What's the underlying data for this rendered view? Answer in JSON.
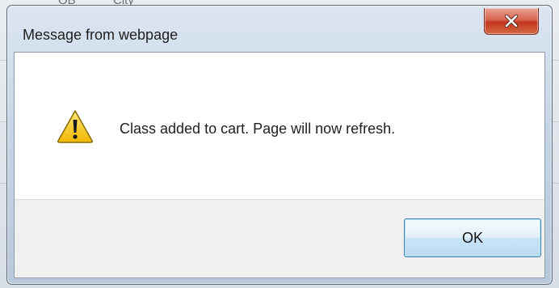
{
  "background_page": {
    "header_cells": [
      "OB",
      "City"
    ]
  },
  "dialog": {
    "title": "Message from webpage",
    "icon": "warning-icon",
    "message": "Class added to cart.  Page will now refresh.",
    "ok_label": "OK",
    "close_icon": "close-icon"
  },
  "colors": {
    "close_button": "#c8452f",
    "ok_button_border": "#3c7fb1",
    "warning_yellow": "#f5c518"
  }
}
